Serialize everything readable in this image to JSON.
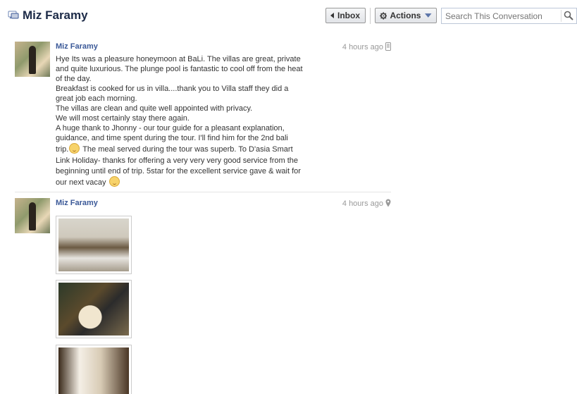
{
  "header": {
    "title": "Miz Faramy",
    "title_icon": "conversation-icon",
    "inbox_label": "Inbox",
    "actions_label": "Actions",
    "search_placeholder": "Search This Conversation"
  },
  "messages": [
    {
      "author": "Miz Faramy",
      "time": "4 hours ago",
      "source_icon": "mobile-icon",
      "lines": [
        "Hye Its was a pleasure honeymoon at BaLi. The villas are great, private",
        "and quite luxurious. The plunge pool is fantastic to cool off from the heat",
        "of the day.",
        "Breakfast is cooked for us in villa....thank you to Villa staff they did a",
        "great job each morning.",
        "The villas are clean and quite well appointed with privacy.",
        "We will most certainly stay there again.",
        "A huge thank to Jhonny - our tour guide for a pleasant explanation,",
        "guidance, and time spent during the tour. I'll find him for the 2nd bali"
      ],
      "line10_a": "trip.",
      "line10_b": " The meal served during the tour was superb. To D'asia Smart",
      "line11": "Link Holiday- thanks for offering a very very very good service from the",
      "line12": "beginning until end of trip. 5star for the excellent service gave & wait for",
      "line13": "our next vacay"
    },
    {
      "author": "Miz Faramy",
      "time": "4 hours ago",
      "source_icon": "location-pin-icon",
      "photos": [
        "villa-living-room-photo",
        "breakfast-table-photo",
        "canopy-bed-photo"
      ]
    }
  ]
}
